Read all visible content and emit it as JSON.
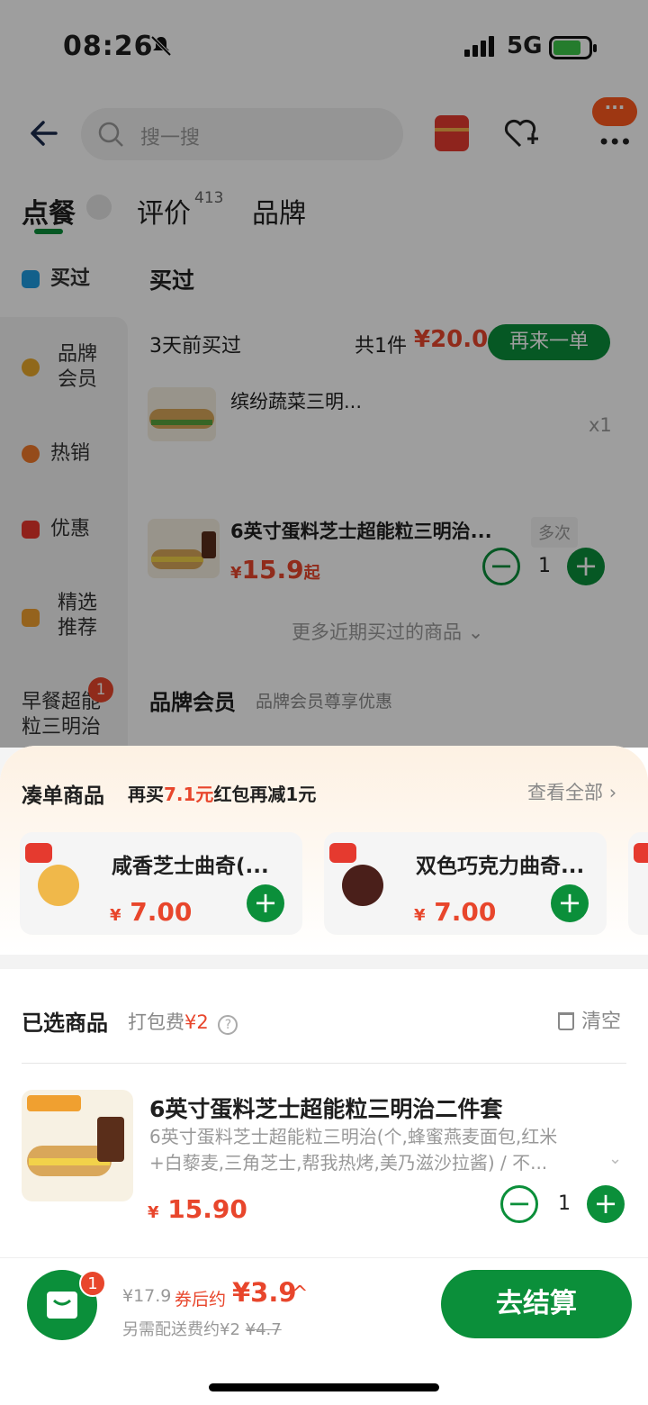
{
  "status": {
    "time": "08:26",
    "network": "5G"
  },
  "header": {
    "search_placeholder": "搜一搜",
    "more_badge": "···"
  },
  "tabs": [
    {
      "label": "点餐"
    },
    {
      "label": "评价",
      "count": "413"
    },
    {
      "label": "品牌"
    }
  ],
  "sidebar": {
    "items": [
      {
        "label": "买过"
      },
      {
        "label": "品牌\n会员"
      },
      {
        "label": "热销"
      },
      {
        "label": "优惠"
      },
      {
        "label": "精选\n推荐"
      },
      {
        "label": "早餐超能\n粒三明治",
        "badge": "1"
      }
    ]
  },
  "main": {
    "section_title": "买过",
    "order": {
      "when": "3天前买过",
      "count_label": "共1件",
      "total": "¥20.0",
      "again_label": "再来一单",
      "item_name": "缤纷蔬菜三明...",
      "item_qty": "x1"
    },
    "product": {
      "name": "6英寸蛋料芝士超能粒三明治...",
      "tag": "多次",
      "price_symbol": "¥",
      "price": "15.9",
      "price_suffix": "起",
      "qty": "1"
    },
    "more_label": "更多近期买过的商品",
    "brand_title": "品牌会员",
    "brand_sub": "品牌会员尊享优惠"
  },
  "sheet": {
    "rec_title": "凑单商品",
    "rec_sub_prefix": "再买",
    "rec_sub_amount": "7.1元",
    "rec_sub_suffix": "红包再减1元",
    "view_all": "查看全部",
    "rec_items": [
      {
        "name": "咸香芝士曲奇(...",
        "price_symbol": "¥",
        "price": "7.00"
      },
      {
        "name": "双色巧克力曲奇...",
        "price_symbol": "¥",
        "price": "7.00"
      }
    ],
    "selected_title": "已选商品",
    "packing_label": "打包费",
    "packing_fee": "¥2",
    "clear_label": "清空",
    "item": {
      "title": "6英寸蛋料芝士超能粒三明治二件套",
      "desc_line1": "6英寸蛋料芝士超能粒三明治(个,蜂蜜燕麦面包,红米",
      "desc_line2": "+白藜麦,三角芝士,帮我热烤,美乃滋沙拉酱) / 不...",
      "price_symbol": "¥",
      "price": "15.90",
      "qty": "1"
    }
  },
  "bottom": {
    "cart_badge": "1",
    "original": "¥17.9",
    "after_label": "券后约",
    "after_price": "¥3.9",
    "delivery_label": "另需配送费约¥2",
    "delivery_strike": "¥4.7",
    "checkout_label": "去结算"
  },
  "colors": {
    "brand_green": "#0b8f3a",
    "price_red": "#e8462c"
  }
}
